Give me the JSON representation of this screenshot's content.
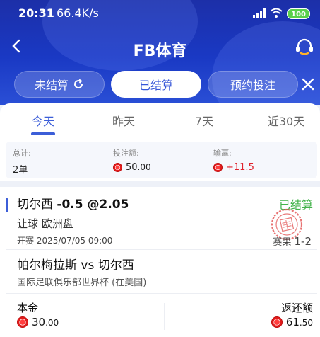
{
  "status_bar": {
    "time": "20:31",
    "speed": "66.4K/s",
    "battery": "100"
  },
  "nav": {
    "title": "FB体育"
  },
  "status_tabs": [
    {
      "label": "未结算",
      "active": false
    },
    {
      "label": "已结算",
      "active": true
    },
    {
      "label": "预约投注",
      "active": false
    }
  ],
  "period_tabs": [
    {
      "label": "今天",
      "active": true
    },
    {
      "label": "昨天",
      "active": false
    },
    {
      "label": "7天",
      "active": false
    },
    {
      "label": "近30天",
      "active": false
    }
  ],
  "summary": {
    "total_label": "总计:",
    "total_value": "2单",
    "stake_label": "投注额:",
    "stake_int": "50",
    "stake_dec": ".00",
    "pnl_label": "输赢:",
    "pnl_value": "+11.5"
  },
  "bet": {
    "team": "切尔西",
    "line": "-0.5 @2.05",
    "status": "已结算",
    "market": "让球 欧洲盘",
    "open_label": "开赛",
    "open_time": "2025/07/05 09:00",
    "result_label": "赛果",
    "score": "1-2",
    "match": "帕尔梅拉斯 vs 切尔西",
    "league": "国际足联俱乐部世界杯 (在美国)",
    "principal_label": "本金",
    "principal_int": "30",
    "principal_dec": ".00",
    "return_label": "返还额",
    "return_int": "61",
    "return_dec": ".50"
  },
  "colors": {
    "header": "#1a39c4",
    "accent": "#3c5ed8",
    "win": "#43b34b",
    "loss_red": "#e0212b"
  }
}
